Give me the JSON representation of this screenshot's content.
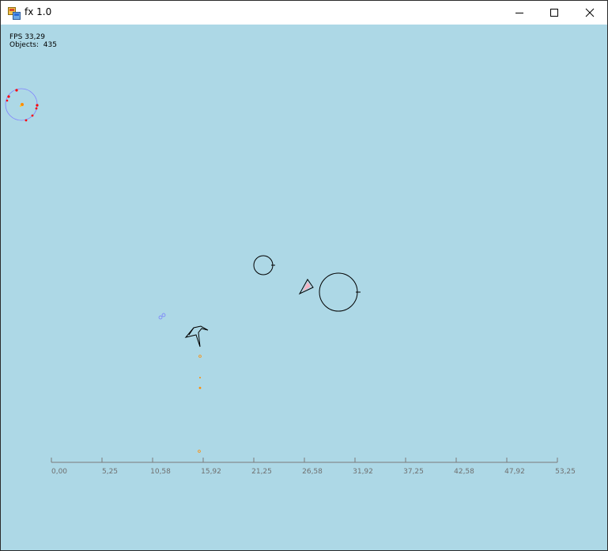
{
  "window": {
    "title": "fx 1.0",
    "icons": {
      "app": "app-window-icon",
      "minimize": "minimize-icon",
      "maximize": "maximize-icon",
      "close": "close-icon"
    }
  },
  "stats": {
    "fps_label": "FPS",
    "fps_value": "33,29",
    "objects_label": "Objects:",
    "objects_value": "435"
  },
  "axis": {
    "ticks": [
      "0,00",
      "5,25",
      "10,58",
      "15,92",
      "21,25",
      "26,58",
      "31,92",
      "37,25",
      "42,58",
      "47,92",
      "53,25"
    ]
  },
  "colors": {
    "background": "#add8e6",
    "outline": "#000000",
    "particle_red": "#ff0000",
    "particle_orange": "#ff8c00",
    "emitter_ring": "#8080ff",
    "axis": "#7a7a7a"
  }
}
